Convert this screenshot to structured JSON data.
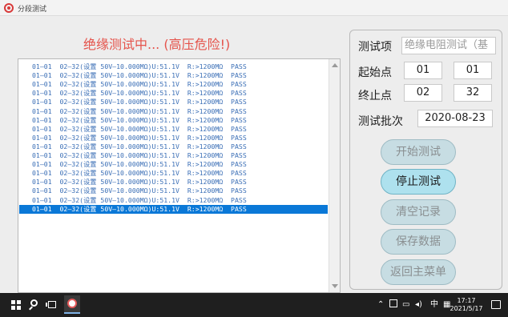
{
  "window": {
    "title": "分段测试"
  },
  "heading": "绝缘测试中... (高压危险!)",
  "log": {
    "lines": [
      "01—01  02—32(设置 50V—10.000MΩ)U:51.1V  R:>1200MΩ  PASS",
      "01—01  02—32(设置 50V—10.000MΩ)U:51.1V  R:>1200MΩ  PASS",
      "01—01  02—32(设置 50V—10.000MΩ)U:51.1V  R:>1200MΩ  PASS",
      "01—01  02—32(设置 50V—10.000MΩ)U:51.1V  R:>1200MΩ  PASS",
      "01—01  02—32(设置 50V—10.000MΩ)U:51.1V  R:>1200MΩ  PASS",
      "01—01  02—32(设置 50V—10.000MΩ)U:51.1V  R:>1200MΩ  PASS",
      "01—01  02—32(设置 50V—10.000MΩ)U:51.1V  R:>1200MΩ  PASS",
      "01—01  02—32(设置 50V—10.000MΩ)U:51.1V  R:>1200MΩ  PASS",
      "01—01  02—32(设置 50V—10.000MΩ)U:51.1V  R:>1200MΩ  PASS",
      "01—01  02—32(设置 50V—10.000MΩ)U:51.1V  R:>1200MΩ  PASS",
      "01—01  02—32(设置 50V—10.000MΩ)U:51.1V  R:>1200MΩ  PASS",
      "01—01  02—32(设置 50V—10.000MΩ)U:51.1V  R:>1200MΩ  PASS",
      "01—01  02—32(设置 50V—10.000MΩ)U:51.1V  R:>1200MΩ  PASS",
      "01—01  02—32(设置 50V—10.000MΩ)U:51.1V  R:>1200MΩ  PASS",
      "01—01  02—32(设置 50V—10.000MΩ)U:51.1V  R:>1200MΩ  PASS",
      "01—01  02—32(设置 50V—10.000MΩ)U:51.1V  R:>1200MΩ  PASS",
      "01—01  02—32(设置 50V—10.000MΩ)U:51.1V  R:>1200MΩ  PASS"
    ],
    "selected_index": 16
  },
  "panel": {
    "test_item_label": "测试项",
    "test_item_value": "绝缘电阻测试（基",
    "start_label": "起始点",
    "start_a": "01",
    "start_b": "01",
    "end_label": "终止点",
    "end_a": "02",
    "end_b": "32",
    "batch_label": "测试批次",
    "batch_value": "2020-08-23"
  },
  "buttons": {
    "start": "开始测试",
    "stop": "停止测试",
    "clear": "清空记录",
    "save": "保存数据",
    "back": "返回主菜单"
  },
  "taskbar": {
    "ime": "中",
    "time": "17:17",
    "date": "2021/5/17"
  },
  "colors": {
    "heading": "#e5534b",
    "log_text": "#3b6fb6",
    "selection": "#0a78d7",
    "button_active": "#aee1ee"
  },
  "icons": [
    "app-logo-icon",
    "windows-start-icon",
    "search-icon",
    "task-view-icon",
    "chevron-up-icon",
    "network-icon",
    "volume-icon",
    "notification-icon"
  ]
}
